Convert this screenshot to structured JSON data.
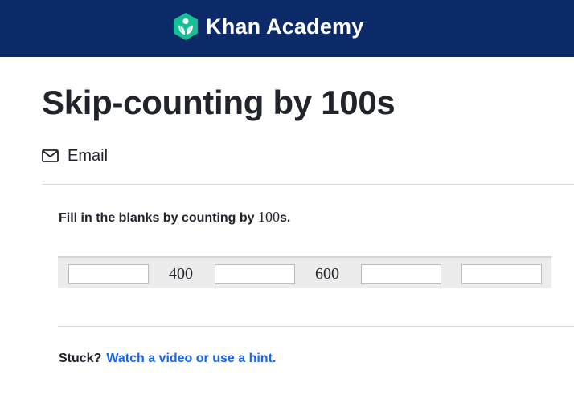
{
  "header": {
    "brand_name": "Khan Academy",
    "logo_icon": "khan-academy-logo-icon",
    "background_color": "#0b2a67",
    "logo_color": "#14bf96"
  },
  "main": {
    "title": "Skip-counting by 100s",
    "email_label": "Email",
    "email_icon": "envelope-icon"
  },
  "exercise": {
    "prompt_text": "Fill in the blanks by counting by ",
    "prompt_math": "100",
    "prompt_suffix": "s.",
    "sequence": [
      {
        "kind": "blank",
        "value": ""
      },
      {
        "kind": "given",
        "value": "400"
      },
      {
        "kind": "blank",
        "value": ""
      },
      {
        "kind": "given",
        "value": "600"
      },
      {
        "kind": "blank",
        "value": ""
      },
      {
        "kind": "blank",
        "value": ""
      }
    ]
  },
  "help": {
    "stuck_label": "Stuck?",
    "hint_link": "Watch a video or use a hint.",
    "link_color": "#1865f2"
  }
}
